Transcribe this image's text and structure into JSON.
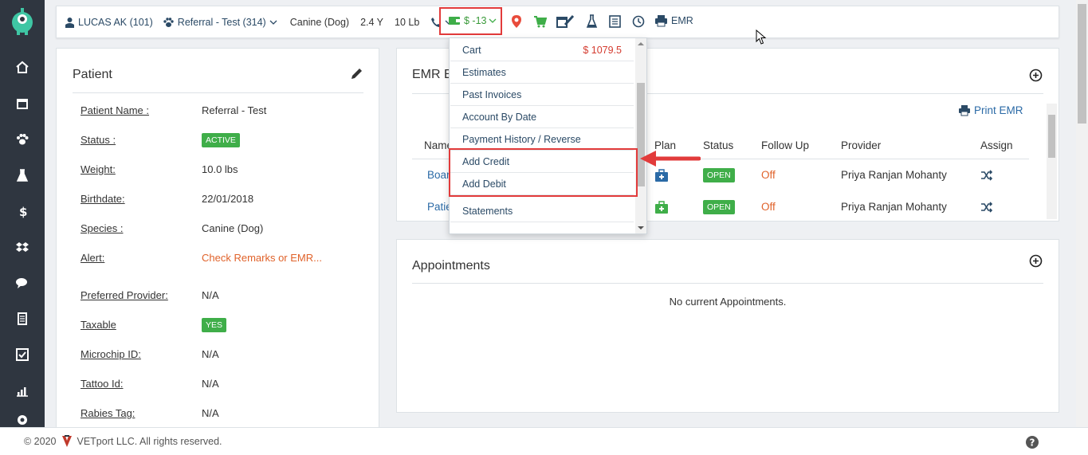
{
  "topbar": {
    "patient": "LUCAS AK (101)",
    "referral": "Referral - Test (314)",
    "species": "Canine (Dog)",
    "age": "2.4 Y",
    "weight": "10 Lb",
    "balance": "$ -13",
    "emr": "EMR"
  },
  "dropdown": {
    "items": [
      {
        "label": "Cart",
        "amount": "$ 1079.5"
      },
      {
        "label": "Estimates"
      },
      {
        "label": "Past Invoices"
      },
      {
        "label": "Account By Date"
      },
      {
        "label": "Payment History / Reverse"
      },
      {
        "label": "Add Credit"
      },
      {
        "label": "Add Debit"
      },
      {
        "label": "Statements"
      }
    ]
  },
  "patient": {
    "title": "Patient",
    "fields": [
      {
        "label": "Patient Name :",
        "value": "Referral - Test"
      },
      {
        "label": "Status :",
        "value": "ACTIVE"
      },
      {
        "label": "Weight:",
        "value": "10.0 lbs"
      },
      {
        "label": "Birthdate:",
        "value": "22/01/2018"
      },
      {
        "label": "Species :",
        "value": "Canine (Dog)"
      },
      {
        "label": "Alert:",
        "value": "Check Remarks or EMR..."
      },
      {
        "label": "Preferred Provider:",
        "value": "N/A"
      },
      {
        "label": "Taxable",
        "value": "YES"
      },
      {
        "label": "Microchip ID:",
        "value": "N/A"
      },
      {
        "label": "Tattoo Id:",
        "value": "N/A"
      },
      {
        "label": "Rabies Tag:",
        "value": "N/A"
      }
    ]
  },
  "emr": {
    "title": "EMR E",
    "print_label": "Print EMR",
    "headers": [
      "Name",
      "Plan",
      "Status",
      "Follow Up",
      "Provider",
      "Assign"
    ],
    "rows": [
      {
        "name": "Boar",
        "status": "OPEN",
        "follow_up": "Off",
        "provider": "Priya Ranjan Mohanty"
      },
      {
        "name": "Patie",
        "status": "OPEN",
        "follow_up": "Off",
        "provider": "Priya Ranjan Mohanty"
      }
    ]
  },
  "appointments": {
    "title": "Appointments",
    "empty": "No current Appointments."
  },
  "footer": {
    "copyright": "© 2020",
    "company": "VETport LLC. All rights reserved."
  },
  "colors": {
    "sidebar": "#2f3640",
    "accent_green": "#3fae49",
    "highlight_red": "#e23b3b",
    "link_blue": "#2b4a66"
  }
}
